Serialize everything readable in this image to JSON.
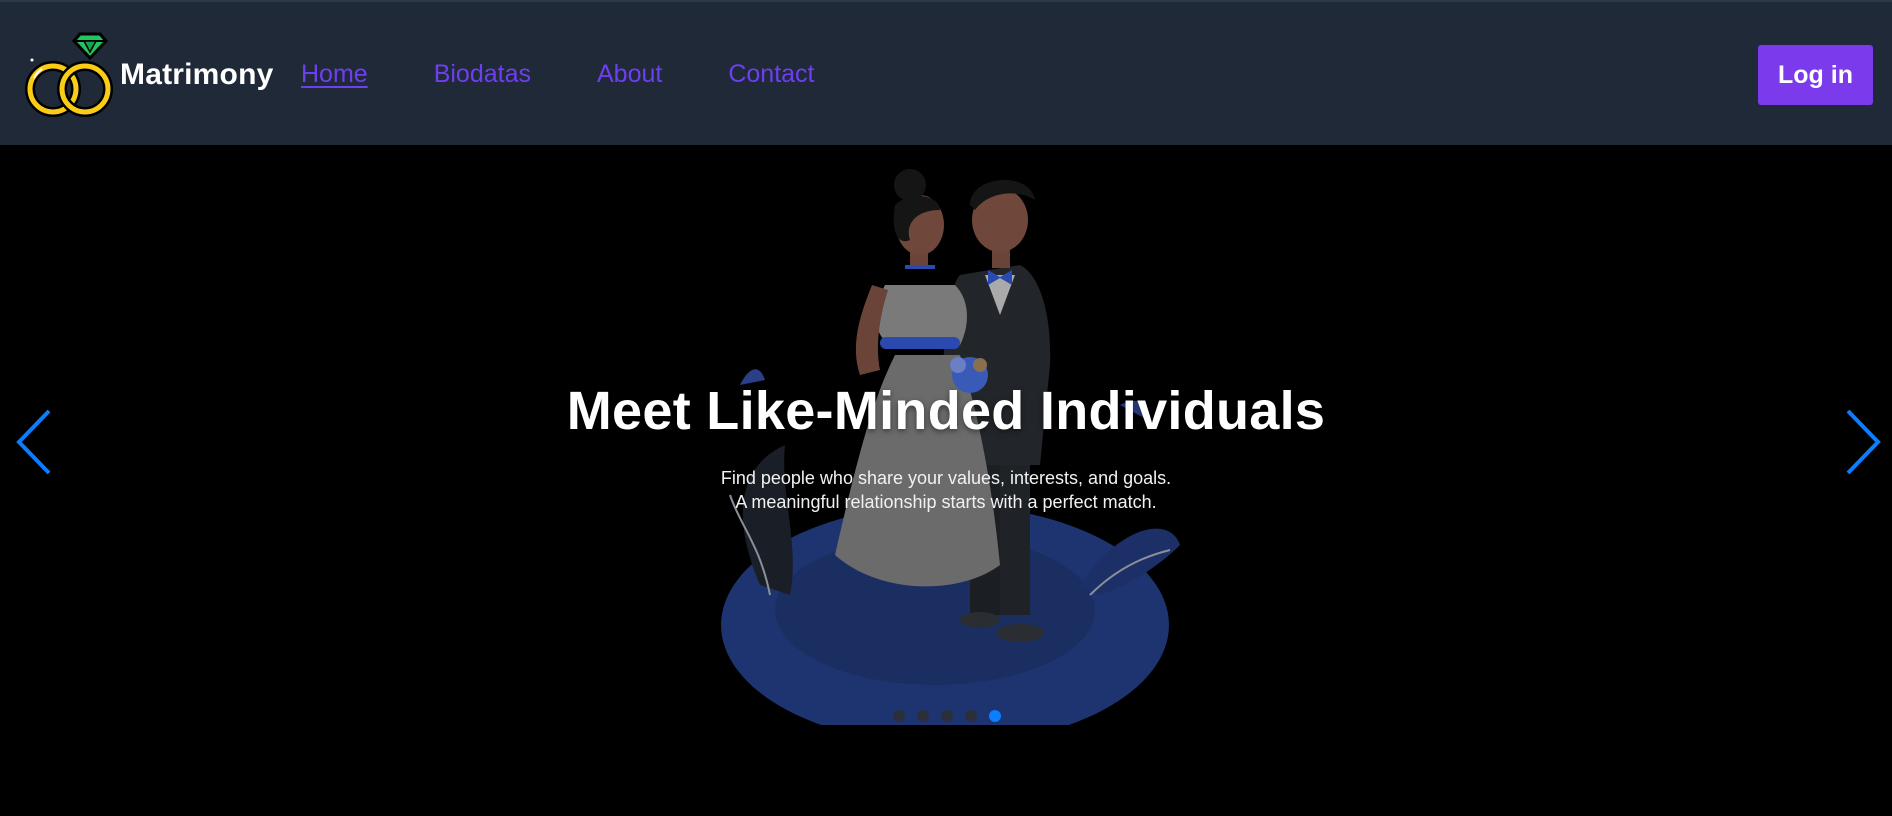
{
  "brand": {
    "name": "Matrimony",
    "logo_icon": "wedding-rings-icon"
  },
  "nav": {
    "items": [
      {
        "label": "Home",
        "active": true
      },
      {
        "label": "Biodatas",
        "active": false
      },
      {
        "label": "About",
        "active": false
      },
      {
        "label": "Contact",
        "active": false
      }
    ],
    "login_label": "Log in"
  },
  "hero": {
    "title": "Meet Like-Minded Individuals",
    "subtitle_line1": "Find people who share your values, interests, and goals.",
    "subtitle_line2": "A meaningful relationship starts with a perfect match.",
    "slide_count": 5,
    "active_slide": 5,
    "prev_icon": "chevron-left-icon",
    "next_icon": "chevron-right-icon"
  },
  "colors": {
    "navbar_bg": "#1f2937",
    "nav_link": "#6d3ff0",
    "login_bg": "#7c3aed",
    "hero_bg": "#000000",
    "arrow": "#0b7dff",
    "indicator_active": "#0b7dff"
  }
}
